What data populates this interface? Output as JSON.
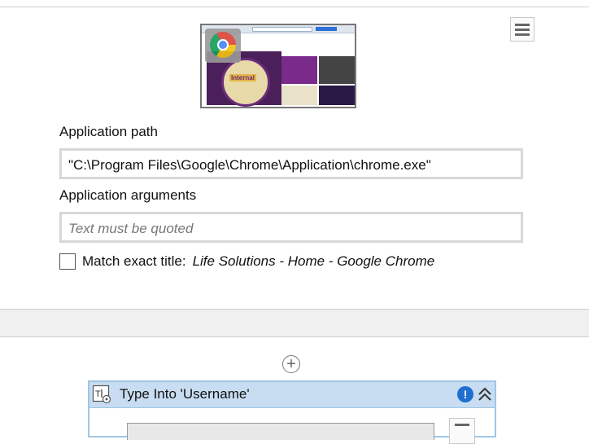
{
  "open_browser": {
    "app_path_label": "Application path",
    "app_path_value": "\"C:\\Program Files\\Google\\Chrome\\Application\\chrome.exe\"",
    "app_args_label": "Application arguments",
    "app_args_placeholder": "Text must be quoted",
    "match_label": "Match exact title:",
    "match_title": "Life Solutions - Home - Google Chrome",
    "match_checked": false,
    "menu_icon": "hamburger-icon",
    "thumbnail_icon": "chrome-icon"
  },
  "designer": {
    "add_icon": "plus-circle-icon"
  },
  "type_into": {
    "title": "Type Into 'Username'",
    "icon": "type-into-icon",
    "warning_icon": "exclamation-icon",
    "collapse_icon": "chevron-double-up-icon"
  },
  "colors": {
    "activity_header": "#c8ddf1",
    "activity_border": "#9ec6e6",
    "warning": "#1f6fd1"
  }
}
